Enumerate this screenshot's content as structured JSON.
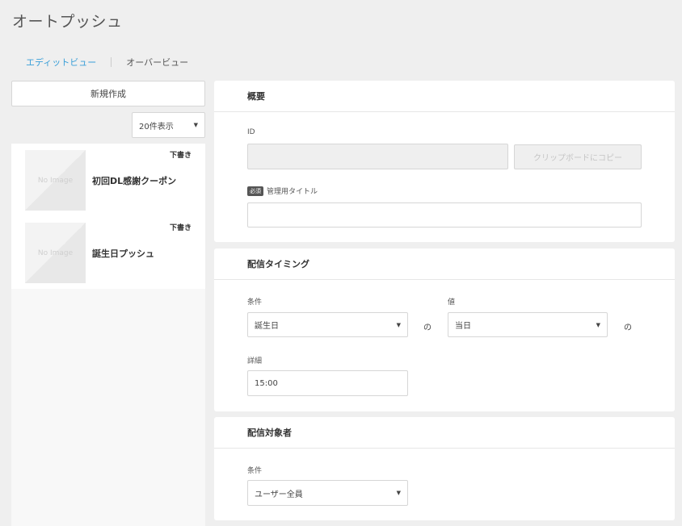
{
  "page": {
    "title": "オートプッシュ"
  },
  "tabs": [
    {
      "label": "エディットビュー",
      "active": true
    },
    {
      "label": "オーバービュー",
      "active": false
    }
  ],
  "sidebar": {
    "new_button_label": "新規作成",
    "per_page": {
      "value": "20件表示"
    },
    "items": [
      {
        "title": "初回DL感謝クーポン",
        "status": "下書き",
        "thumb_text": "No Image"
      },
      {
        "title": "誕生日プッシュ",
        "status": "下書き",
        "thumb_text": "No Image"
      }
    ]
  },
  "overview": {
    "heading": "概要",
    "id_label": "ID",
    "id_value": "",
    "copy_button_label": "クリップボードにコピー",
    "required_badge": "必須",
    "title_label": "管理用タイトル",
    "title_value": ""
  },
  "timing": {
    "heading": "配信タイミング",
    "condition_label": "条件",
    "condition_value": "誕生日",
    "particle_1": "の",
    "value_label": "値",
    "value_value": "当日",
    "particle_2": "の",
    "detail_label": "詳細",
    "detail_value": "15:00"
  },
  "audience": {
    "heading": "配信対象者",
    "condition_label": "条件",
    "condition_value": "ユーザー全員"
  },
  "icons": {
    "caret": "caret-down-icon"
  },
  "colors": {
    "accent": "#3a9fd8",
    "background": "#efefef"
  }
}
